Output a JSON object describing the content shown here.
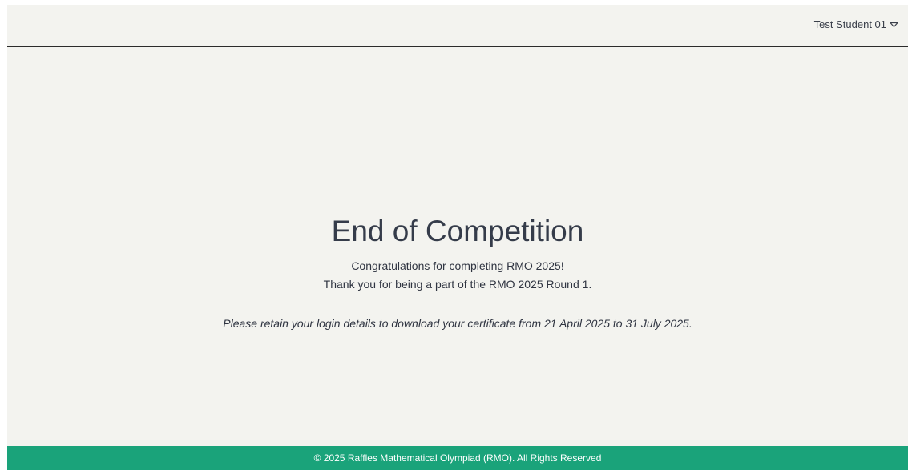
{
  "header": {
    "user_name": "Test Student 01",
    "user_menu_icon": "chevron-down-outline-icon"
  },
  "main": {
    "title": "End of Competition",
    "congrats": "Congratulations for completing RMO 2025!",
    "thanks": "Thank you for being a part of the RMO 2025 Round 1.",
    "notice": "Please retain your login details to download your certificate from 21 April 2025 to 31 July 2025."
  },
  "footer": {
    "copyright": "© 2025 Raffles Mathematical Olympiad (RMO). All Rights Reserved"
  },
  "colors": {
    "background": "#f3f3ef",
    "footer": "#1aa37a",
    "text": "#2f3441"
  }
}
